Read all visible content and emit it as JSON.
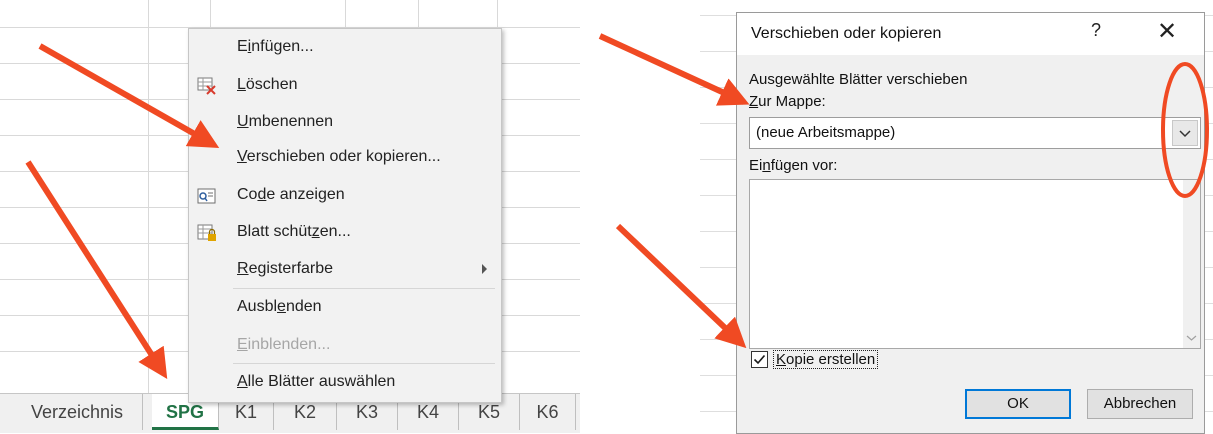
{
  "left": {
    "context_menu": {
      "items": [
        {
          "pre": "E",
          "ul": "i",
          "post": "nfügen...",
          "icon": "none"
        },
        {
          "pre": "",
          "ul": "L",
          "post": "öschen",
          "icon": "delete-sheet-icon"
        },
        {
          "pre": "",
          "ul": "U",
          "post": "mbenennen",
          "icon": "none"
        },
        {
          "pre": "",
          "ul": "V",
          "post": "erschieben oder kopieren...",
          "icon": "none"
        },
        {
          "pre": "Co",
          "ul": "d",
          "post": "e anzeigen",
          "icon": "view-code-icon"
        },
        {
          "pre": "Blatt schüt",
          "ul": "z",
          "post": "en...",
          "icon": "protect-sheet-icon"
        },
        {
          "pre": "",
          "ul": "R",
          "post": "egisterfarbe",
          "icon": "none",
          "submenu": true
        },
        {
          "pre": "Ausbl",
          "ul": "e",
          "post": "nden",
          "icon": "none"
        },
        {
          "pre": "",
          "ul": "E",
          "post": "inblenden...",
          "icon": "none",
          "disabled": true
        },
        {
          "pre": "",
          "ul": "A",
          "post": "lle Blätter auswählen",
          "icon": "none"
        }
      ]
    },
    "sheet_tabs": [
      "Verzeichnis",
      "SPG",
      "K1",
      "K2",
      "K3",
      "K4",
      "K5",
      "K6"
    ],
    "active_tab": "SPG"
  },
  "dialog": {
    "title": "Verschieben oder kopieren",
    "help": "?",
    "close": "✕",
    "section_label": "Ausgewählte Blätter verschieben",
    "to_book_pre": "",
    "to_book_ul": "Z",
    "to_book_post": "ur Mappe:",
    "to_book_value": "(neue Arbeitsmappe)",
    "insert_before_pre": "Ei",
    "insert_before_ul": "n",
    "insert_before_post": "fügen vor:",
    "copy_pre": "",
    "copy_ul": "K",
    "copy_post": "opie erstellen",
    "copy_checked": true,
    "ok_label": "OK",
    "cancel_label": "Abbrechen"
  },
  "colors": {
    "arrow": "#f04a23",
    "excel_green": "#217346",
    "dialog_accent": "#0078d7"
  }
}
